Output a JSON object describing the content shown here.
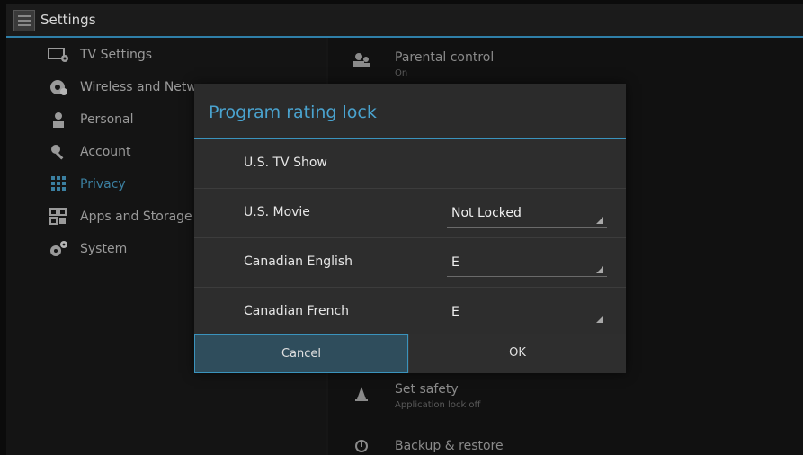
{
  "app": {
    "title": "Settings"
  },
  "sidebar": {
    "items": [
      {
        "label": "TV Settings",
        "icon": "tv-gear-icon",
        "active": false
      },
      {
        "label": "Wireless and Netwo",
        "icon": "network-icon",
        "active": false
      },
      {
        "label": "Personal",
        "icon": "person-icon",
        "active": false
      },
      {
        "label": "Account",
        "icon": "key-icon",
        "active": false
      },
      {
        "label": "Privacy",
        "icon": "privacy-grid-icon",
        "active": true
      },
      {
        "label": "Apps and Storage",
        "icon": "apps-icon",
        "active": false
      },
      {
        "label": "System",
        "icon": "gears-icon",
        "active": false
      }
    ]
  },
  "main": {
    "parental": {
      "title": "Parental control",
      "subtitle": "On",
      "icon": "parental-icon"
    },
    "safety": {
      "title": "Set safety",
      "subtitle": "Application lock off",
      "icon": "cone-icon"
    },
    "backup": {
      "title": "Backup & restore",
      "icon": "backup-icon"
    }
  },
  "dialog": {
    "title": "Program rating lock",
    "rows": [
      {
        "label": "U.S. TV Show",
        "value": ""
      },
      {
        "label": "U.S. Movie",
        "value": "Not Locked"
      },
      {
        "label": "Canadian English",
        "value": "E"
      },
      {
        "label": "Canadian French",
        "value": "E"
      }
    ],
    "cancel_label": "Cancel",
    "ok_label": "OK"
  },
  "colors": {
    "accent": "#3a93bd",
    "privacy_active": "#3b7fa0",
    "dialog_bg": "#2d2d2d"
  }
}
